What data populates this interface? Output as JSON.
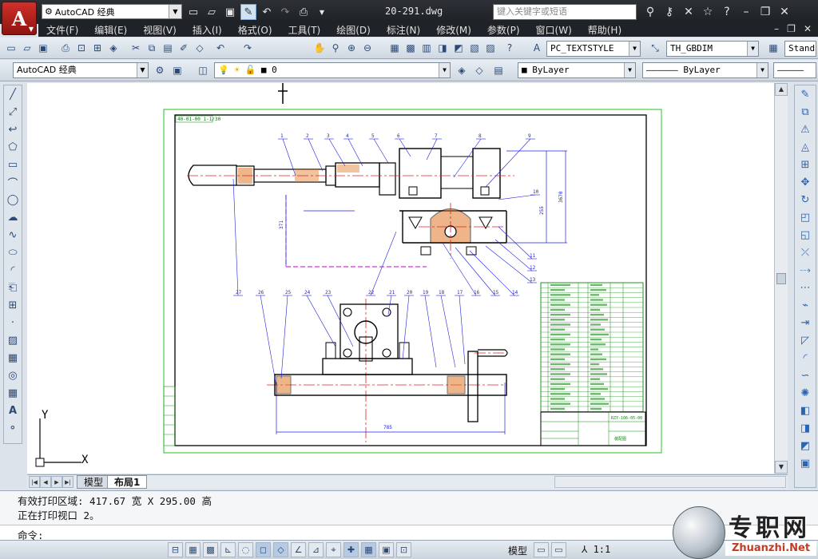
{
  "window": {
    "workspace": "AutoCAD 经典",
    "document_title": "20-291.dwg",
    "search_placeholder": "键入关键字或短语",
    "app_logo_letter": "A"
  },
  "menu": [
    "文件(F)",
    "编辑(E)",
    "视图(V)",
    "插入(I)",
    "格式(O)",
    "工具(T)",
    "绘图(D)",
    "标注(N)",
    "修改(M)",
    "参数(P)",
    "窗口(W)",
    "帮助(H)"
  ],
  "toolbar": {
    "text_style": "PC_TEXTSTYLE",
    "dim_style": "TH_GBDIM",
    "table_style": "Standa",
    "workspace2": "AutoCAD 经典",
    "layer": "0",
    "color": "ByLayer",
    "linetype": "ByLayer"
  },
  "tabs": {
    "model": "模型",
    "layout": "布局1"
  },
  "command_line": {
    "line1": "有效打印区域:  417.67 宽 X 295.00 高",
    "line2": "正在打印视口 2。",
    "prompt": "命令:"
  },
  "statusbar": {
    "model_label": "模型",
    "scale": "1:1"
  },
  "watermark": {
    "text": "专职网",
    "url": "Zhuanzhi.Net"
  },
  "drawing": {
    "drawing_no": "40-01-00 1-1/30",
    "dims": {
      "overall_width": "785",
      "h1": "255",
      "h2": "3670",
      "v_left": "371"
    },
    "balloons": [
      "1",
      "2",
      "3",
      "4",
      "5",
      "6",
      "7",
      "8",
      "9",
      "10",
      "11",
      "12",
      "13",
      "14",
      "15",
      "16",
      "17",
      "18",
      "19",
      "20",
      "21",
      "22",
      "23",
      "24",
      "25",
      "26",
      "27"
    ],
    "title_block_name": "RZY-106-05-00",
    "title_block_label": "装配图"
  },
  "ucs": {
    "x": "X",
    "y": "Y"
  }
}
